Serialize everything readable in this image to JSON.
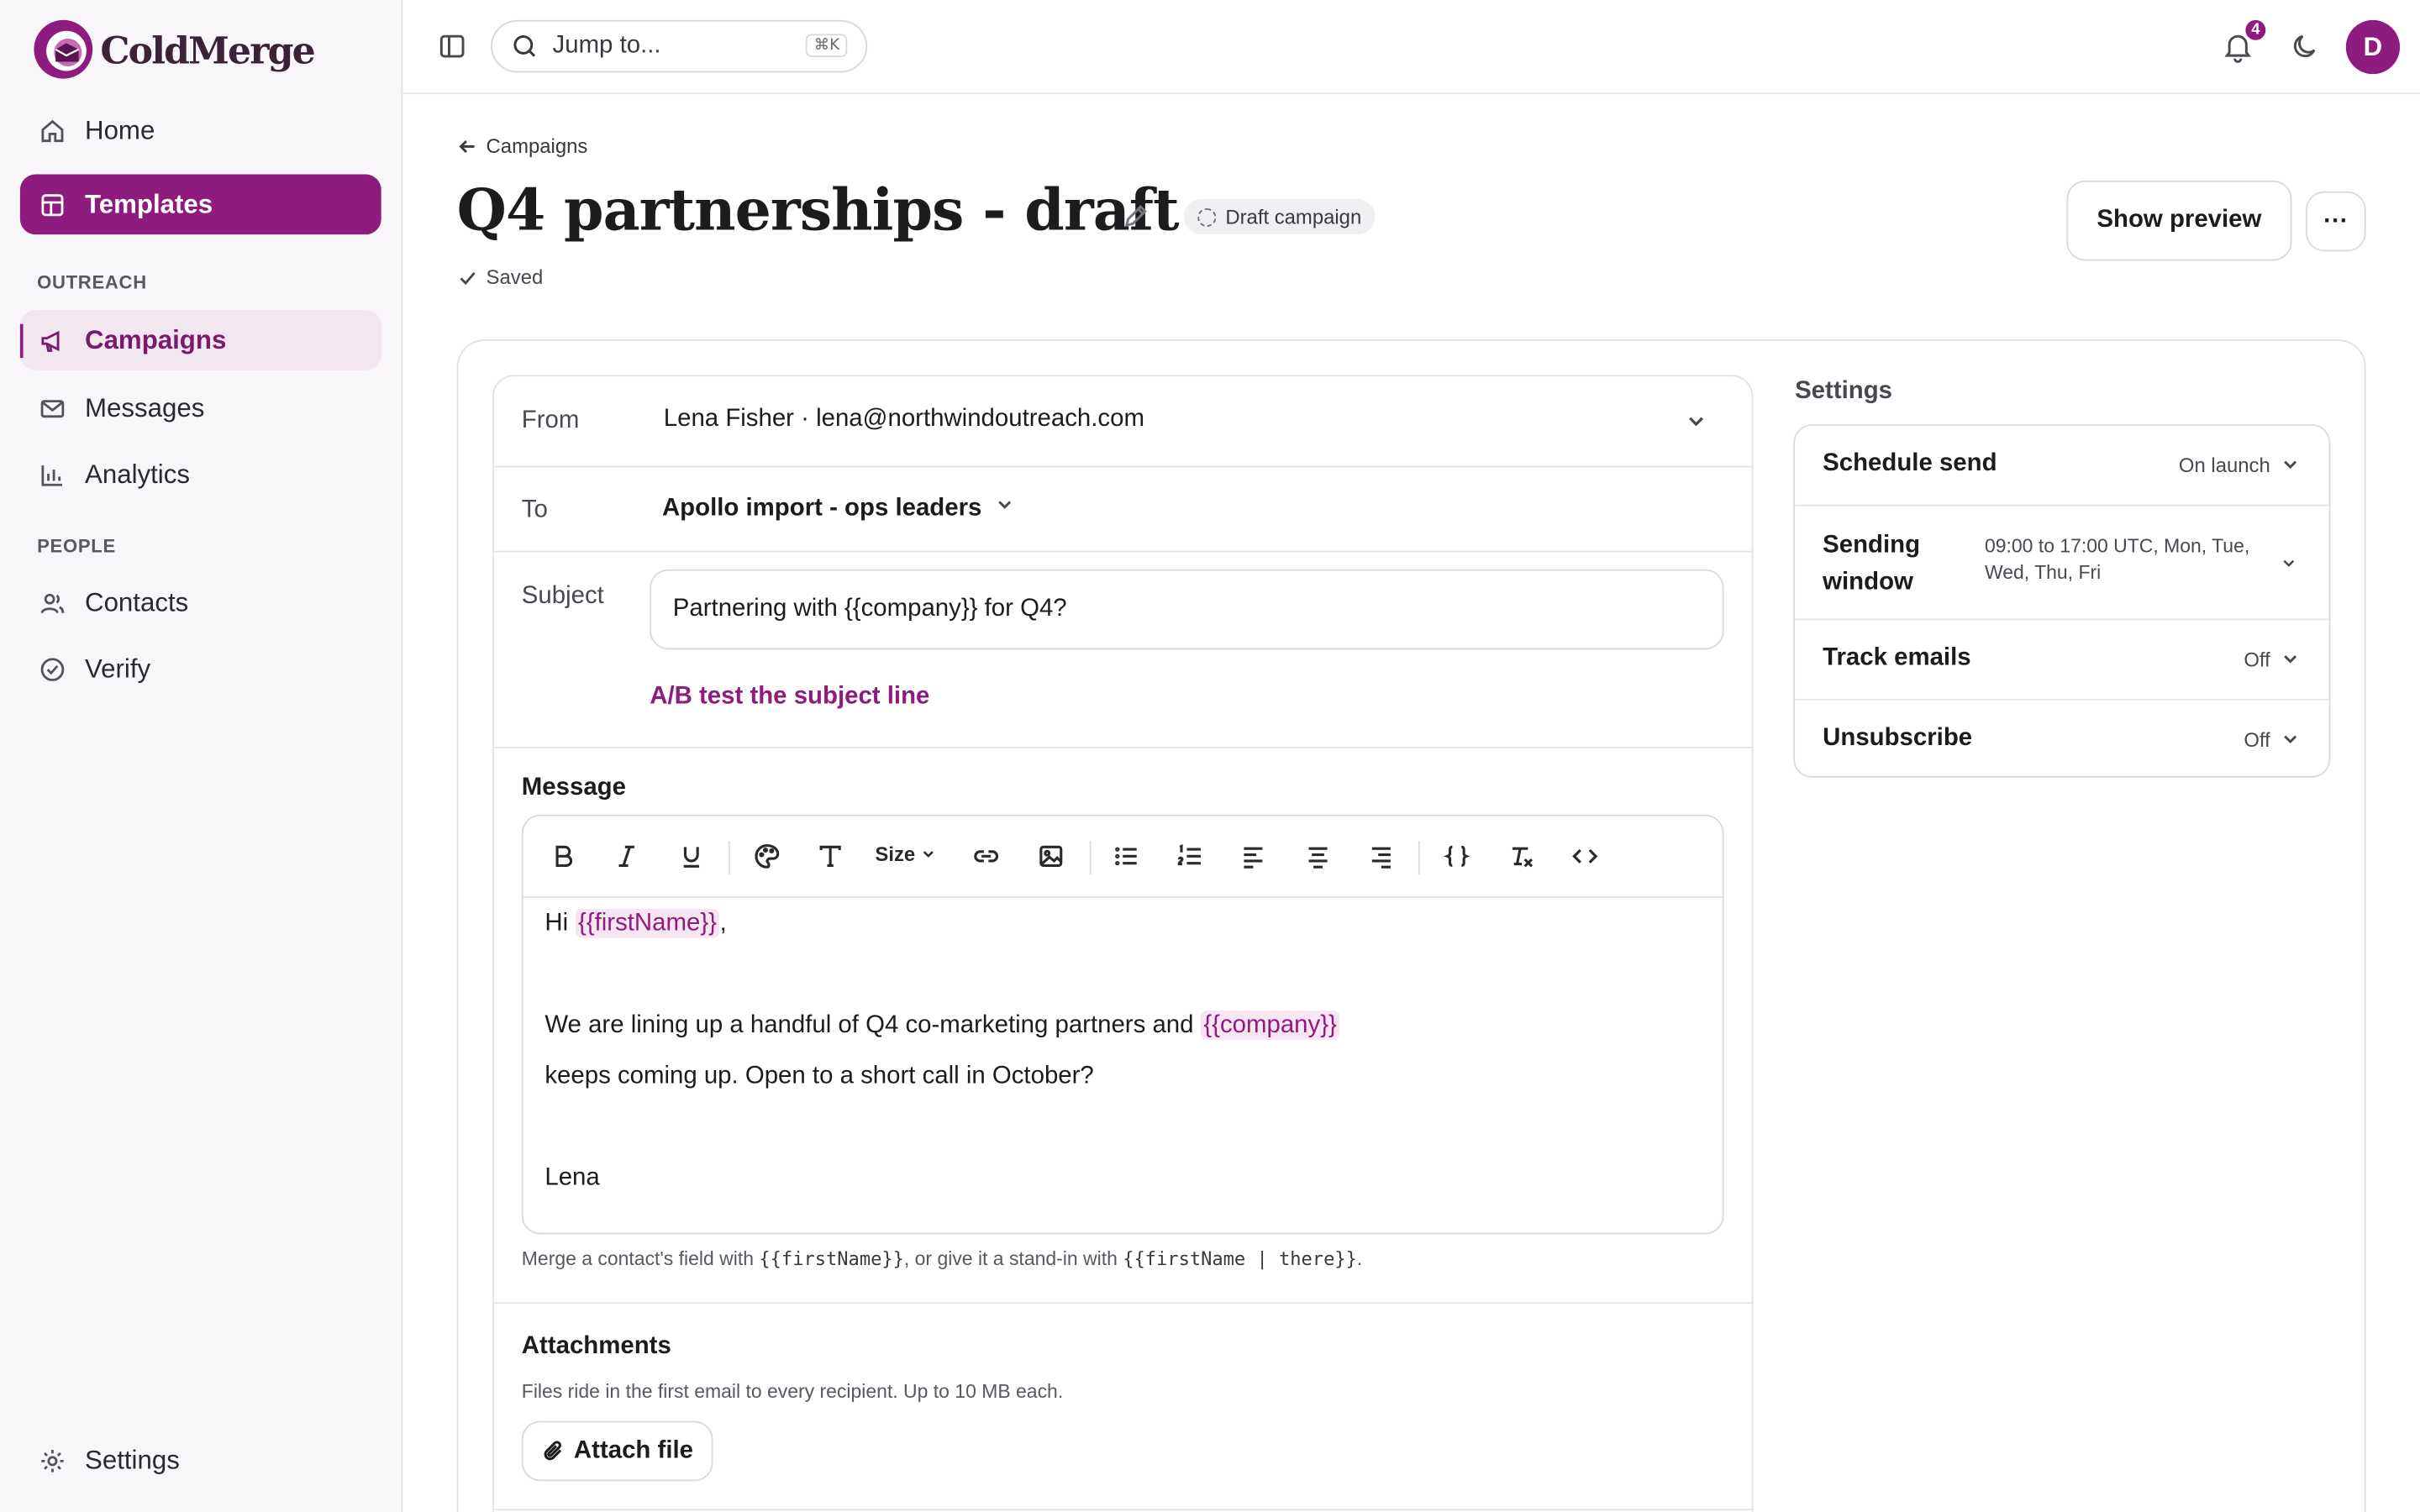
{
  "brand": {
    "name": "ColdMerge",
    "accent": "#8e1c7e"
  },
  "sidebar": {
    "home": "Home",
    "templates": "Templates",
    "outreach_label": "OUTREACH",
    "campaigns": "Campaigns",
    "messages": "Messages",
    "analytics": "Analytics",
    "people_label": "PEOPLE",
    "contacts": "Contacts",
    "verify": "Verify",
    "settings": "Settings"
  },
  "topbar": {
    "search_placeholder": "Jump to...",
    "search_shortcut": "⌘K",
    "notification_count": "4",
    "avatar_initial": "D"
  },
  "header": {
    "back_label": "Campaigns",
    "title": "Q4 partnerships - draft",
    "status": "Draft campaign",
    "saved": "Saved",
    "preview_button": "Show preview",
    "more_button": "···"
  },
  "compose": {
    "from_label": "From",
    "from_value": "Lena Fisher · lena@northwindoutreach.com",
    "to_label": "To",
    "to_value": "Apollo import - ops leaders",
    "subject_label": "Subject",
    "subject_value": "Partnering with {{company}} for Q4?",
    "ab_link": "A/B test the subject line",
    "message_label": "Message",
    "toolbar_size": "Size",
    "body": {
      "greeting": "Hi",
      "greeting_chip": "{{firstName}}",
      "greeting_tail": ",",
      "para_a": "We are lining up a handful of Q4 co-marketing partners and",
      "para_chip": "{{company}}",
      "para_b": "keeps coming up. Open to a short call in October?",
      "signoff": "Lena"
    },
    "hint_a": "Merge a contact's field with ",
    "hint_code_a": "{{firstName}}",
    "hint_b": ", or give it a stand-in with ",
    "hint_code_b": "{{firstName | there}}",
    "hint_c": ".",
    "attachments_label": "Attachments",
    "attachments_sub": "Files ride in the first email to every recipient. Up to 10 MB each.",
    "attach_button": "Attach file"
  },
  "settings": {
    "title": "Settings",
    "rows": [
      {
        "name": "Schedule send",
        "value": "On launch"
      },
      {
        "name_a": "Sending",
        "name_b": "window",
        "value_a": "09:00 to 17:00 UTC, Mon, Tue,",
        "value_b": "Wed, Thu, Fri"
      },
      {
        "name": "Track emails",
        "value": "Off"
      },
      {
        "name": "Unsubscribe",
        "value": "Off"
      }
    ]
  }
}
